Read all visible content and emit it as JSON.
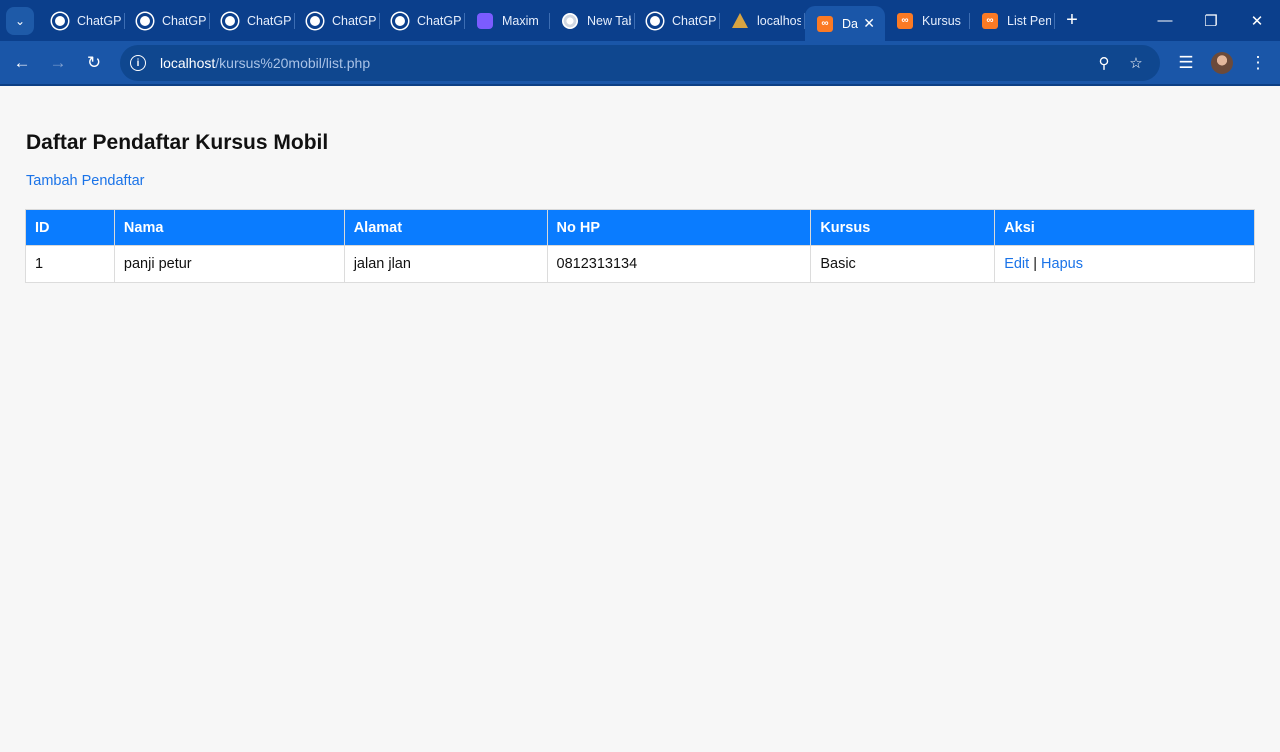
{
  "browser": {
    "tabs": [
      {
        "title": "ChatGPT",
        "icon": "chatgpt-icon",
        "active": false
      },
      {
        "title": "ChatGPT",
        "icon": "chatgpt-icon",
        "active": false
      },
      {
        "title": "ChatGPT",
        "icon": "chatgpt-icon",
        "active": false
      },
      {
        "title": "ChatGPT",
        "icon": "chatgpt-icon",
        "active": false
      },
      {
        "title": "ChatGPT",
        "icon": "chatgpt-icon",
        "active": false
      },
      {
        "title": "Maxim",
        "icon": "maxim-icon",
        "active": false
      },
      {
        "title": "New Tab",
        "icon": "chrome-icon",
        "active": false
      },
      {
        "title": "ChatGPT",
        "icon": "chatgpt-icon",
        "active": false
      },
      {
        "title": "localhost",
        "icon": "localhost-icon",
        "active": false
      },
      {
        "title": "Daftar",
        "icon": "xampp-icon",
        "active": true
      },
      {
        "title": "Kursus",
        "icon": "xampp-icon",
        "active": false
      },
      {
        "title": "List Pen",
        "icon": "xampp-icon",
        "active": false
      }
    ],
    "url_host": "localhost",
    "url_path": "/kursus%20mobil/list.php"
  },
  "page": {
    "title": "Daftar Pendaftar Kursus Mobil",
    "add_link": "Tambah Pendaftar",
    "table": {
      "headers": {
        "id": "ID",
        "nama": "Nama",
        "alamat": "Alamat",
        "no_hp": "No HP",
        "kursus": "Kursus",
        "aksi": "Aksi"
      },
      "rows": [
        {
          "id": "1",
          "nama": "panji petur",
          "alamat": "jalan jlan",
          "no_hp": "0812313134",
          "kursus": "Basic",
          "edit": "Edit",
          "separator": "|",
          "hapus": "Hapus"
        }
      ]
    }
  },
  "colors": {
    "tabstrip": "#0b3f8c",
    "toolbar": "#1a56a8",
    "table_header": "#0a7cff",
    "link": "#1a73e8"
  }
}
